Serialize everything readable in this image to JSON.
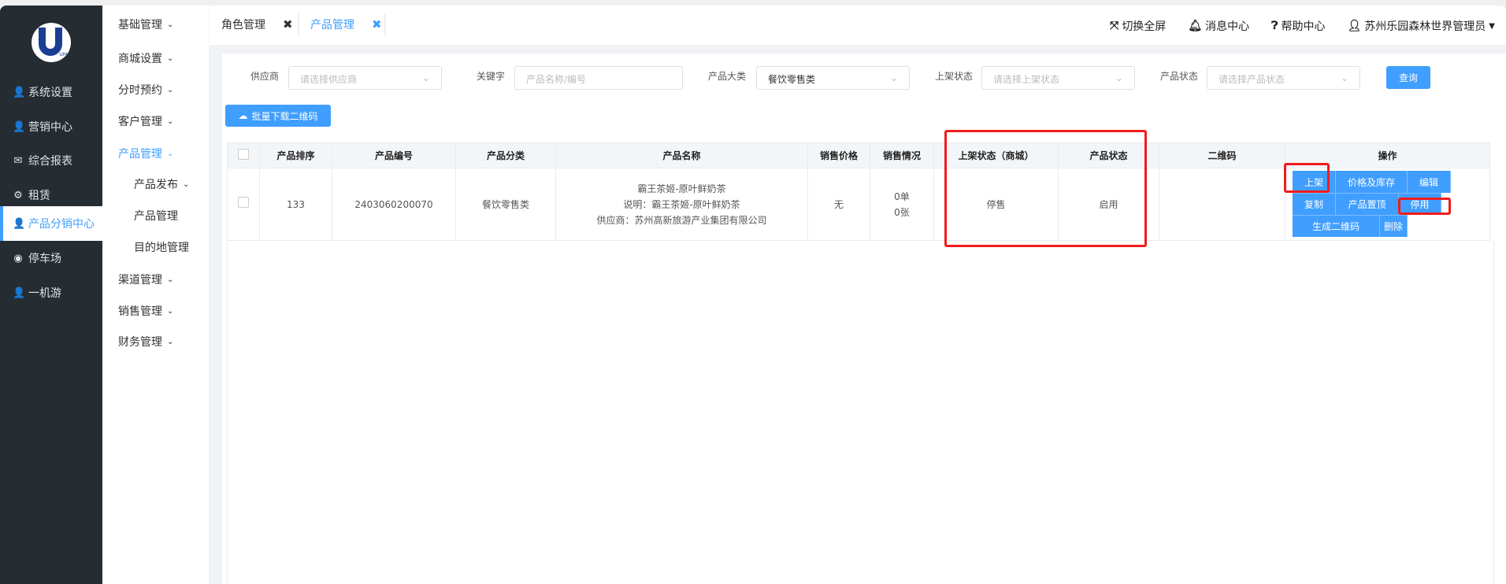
{
  "logo_text": "UM",
  "sidebar": {
    "items": [
      {
        "label": "系统设置",
        "icon": "user-icon"
      },
      {
        "label": "营销中心",
        "icon": "user-icon"
      },
      {
        "label": "综合报表",
        "icon": "envelope-icon"
      },
      {
        "label": "租赁",
        "icon": "gear-icon"
      },
      {
        "label": "产品分销中心",
        "icon": "user-icon",
        "active": true
      },
      {
        "label": "停车场",
        "icon": "compass-icon"
      },
      {
        "label": "一机游",
        "icon": "user-icon"
      }
    ]
  },
  "submenu": {
    "items": [
      {
        "label": "基础管理"
      },
      {
        "label": "商城设置"
      },
      {
        "label": "分时预约"
      },
      {
        "label": "客户管理"
      },
      {
        "label": "产品管理",
        "active": true
      },
      {
        "label": "产品发布"
      },
      {
        "label": "产品管理"
      },
      {
        "label": "目的地管理"
      },
      {
        "label": "渠道管理"
      },
      {
        "label": "销售管理"
      },
      {
        "label": "财务管理"
      }
    ]
  },
  "tabs": [
    {
      "label": "角色管理"
    },
    {
      "label": "产品管理",
      "active": true
    }
  ],
  "header": {
    "fullscreen": "切换全屏",
    "messages": "消息中心",
    "help": "帮助中心",
    "user": "苏州乐园森林世界管理员"
  },
  "filters": {
    "supplier_label": "供应商",
    "supplier_placeholder": "请选择供应商",
    "keyword_label": "关键字",
    "keyword_placeholder": "产品名称/编号",
    "category_label": "产品大类",
    "category_value": "餐饮零售类",
    "shelf_label": "上架状态",
    "shelf_placeholder": "请选择上架状态",
    "status_label": "产品状态",
    "status_placeholder": "请选择产品状态",
    "query": "查询"
  },
  "batch_download": "批量下载二维码",
  "table": {
    "columns": [
      "产品排序",
      "产品编号",
      "产品分类",
      "产品名称",
      "销售价格",
      "销售情况",
      "上架状态（商城）",
      "产品状态",
      "二维码",
      "操作"
    ],
    "rows": [
      {
        "sort": "133",
        "code": "2403060200070",
        "category": "餐饮零售类",
        "name": "霸王茶姬-原叶鲜奶茶",
        "desc": "说明：霸王茶姬-原叶鲜奶茶",
        "supplier": "供应商：苏州高新旅游产业集团有限公司",
        "price": "无",
        "sales_orders": "0单",
        "sales_count": "0张",
        "shelf_status": "停售",
        "product_status": "启用",
        "qrcode": "",
        "actions": [
          "上架",
          "价格及库存",
          "编辑",
          "复制",
          "产品置顶",
          "停用",
          "生成二维码",
          "删除"
        ]
      }
    ]
  },
  "colors": {
    "accent": "#409eff",
    "sidebar": "#252d33",
    "highlight": "#f01c1c"
  }
}
